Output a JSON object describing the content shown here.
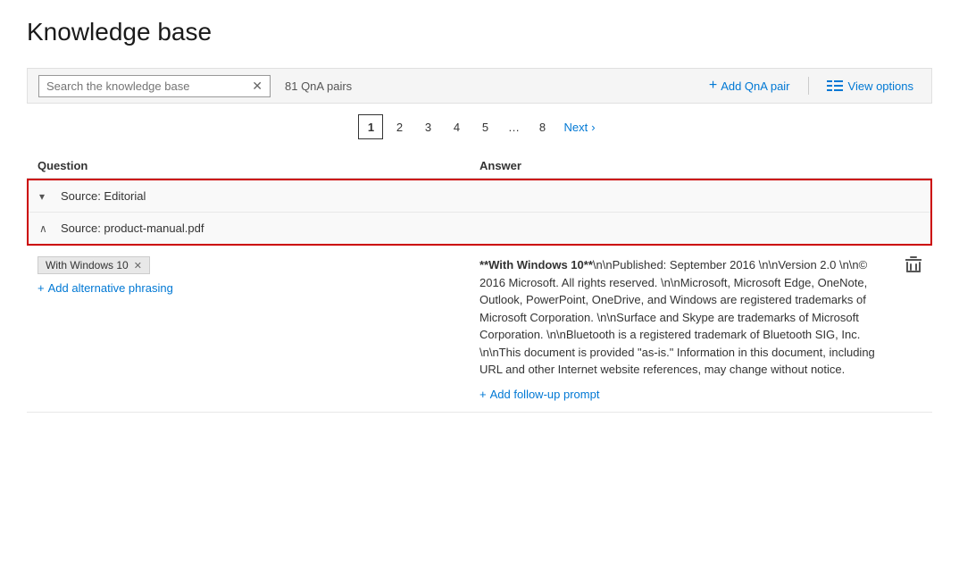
{
  "page": {
    "title": "Knowledge base"
  },
  "toolbar": {
    "search_placeholder": "Search the knowledge base",
    "qna_count": "81 QnA pairs",
    "add_qna_label": "Add QnA pair",
    "view_options_label": "View options"
  },
  "pagination": {
    "pages": [
      "1",
      "2",
      "3",
      "4",
      "5",
      "…",
      "8"
    ],
    "active_page": "1",
    "next_label": "Next"
  },
  "table": {
    "col_question": "Question",
    "col_answer": "Answer"
  },
  "sources": [
    {
      "label": "Source: Editorial",
      "expanded": false,
      "chevron": "▾"
    },
    {
      "label": "Source: product-manual.pdf",
      "expanded": true,
      "chevron": "∧"
    }
  ],
  "qna_row": {
    "question_tag": "With Windows 10",
    "add_phrasing_label": "Add alternative phrasing",
    "answer_text": "**With Windows 10**\\n\\nPublished: September 2016 \\n\\nVersion 2.0 \\n\\n© 2016 Microsoft. All rights reserved. \\n\\nMicrosoft, Microsoft Edge, OneNote, Outlook, PowerPoint, OneDrive, and Windows are registered trademarks of Microsoft Corporation. \\n\\nSurface and Skype are trademarks of Microsoft Corporation. \\n\\nBluetooth is a registered trademark of Bluetooth SIG, Inc. \\n\\nThis document is provided \"as-is.\" Information in this document, including URL and other Internet website references, may change without notice.",
    "add_followup_label": "Add follow-up prompt",
    "delete_icon": "🗑"
  },
  "colors": {
    "accent_blue": "#0078d4",
    "source_border": "#cc0000",
    "active_page_border": "#333"
  }
}
